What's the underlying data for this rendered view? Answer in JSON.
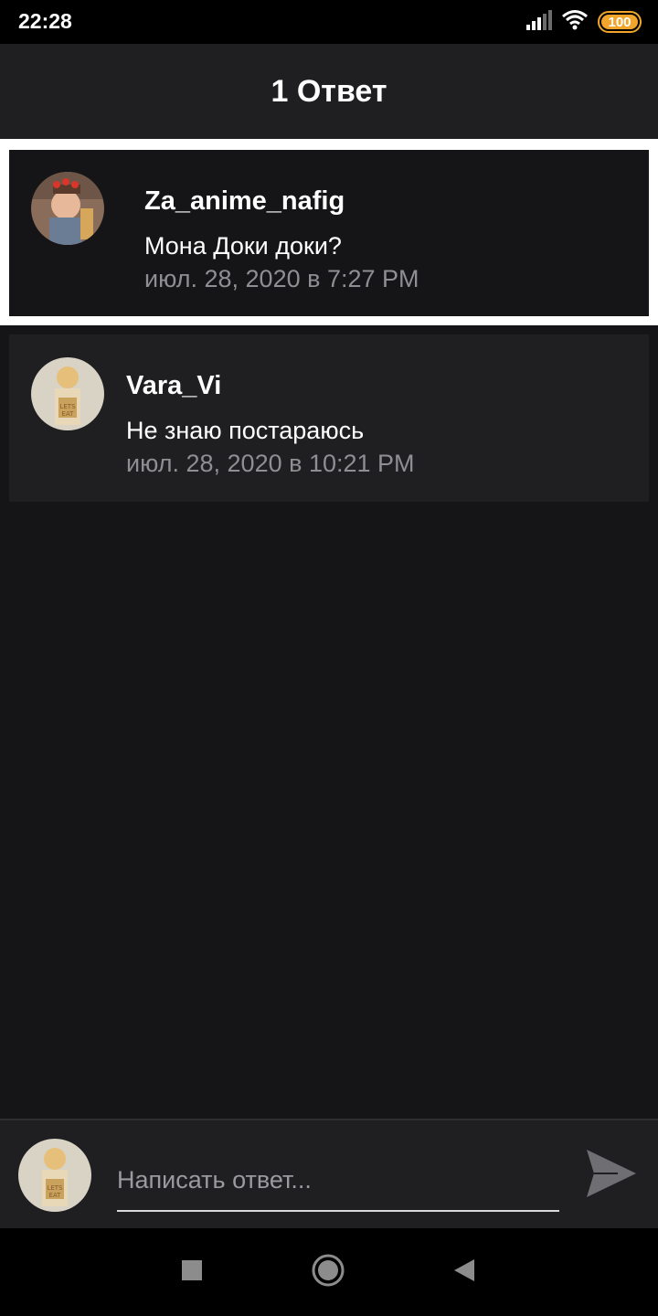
{
  "status_bar": {
    "time": "22:28",
    "battery_level": 100,
    "battery_label": "100",
    "icons": [
      "signal-icon",
      "wifi-icon",
      "battery-icon"
    ],
    "battery_color": "#f2a52a"
  },
  "header": {
    "title": "1 Ответ"
  },
  "parent_comment": {
    "author": "Za_anime_nafig",
    "text": "Мона Доки доки?",
    "date": "июл. 28, 2020 в 7:27 PM"
  },
  "replies": [
    {
      "author": "Vara_Vi",
      "text": "Не знаю постараюсь",
      "date": "июл. 28, 2020 в 10:21 PM"
    }
  ],
  "composer": {
    "placeholder": "Написать ответ...",
    "value": "",
    "send_icon": "send-icon"
  },
  "nav_bar": {
    "buttons": [
      "recent-apps-icon",
      "home-icon",
      "back-icon"
    ]
  },
  "colors": {
    "background": "#151416",
    "card": "#1f1e20",
    "highlight_border": "#ffffff",
    "secondary_text": "#8f8e92"
  }
}
